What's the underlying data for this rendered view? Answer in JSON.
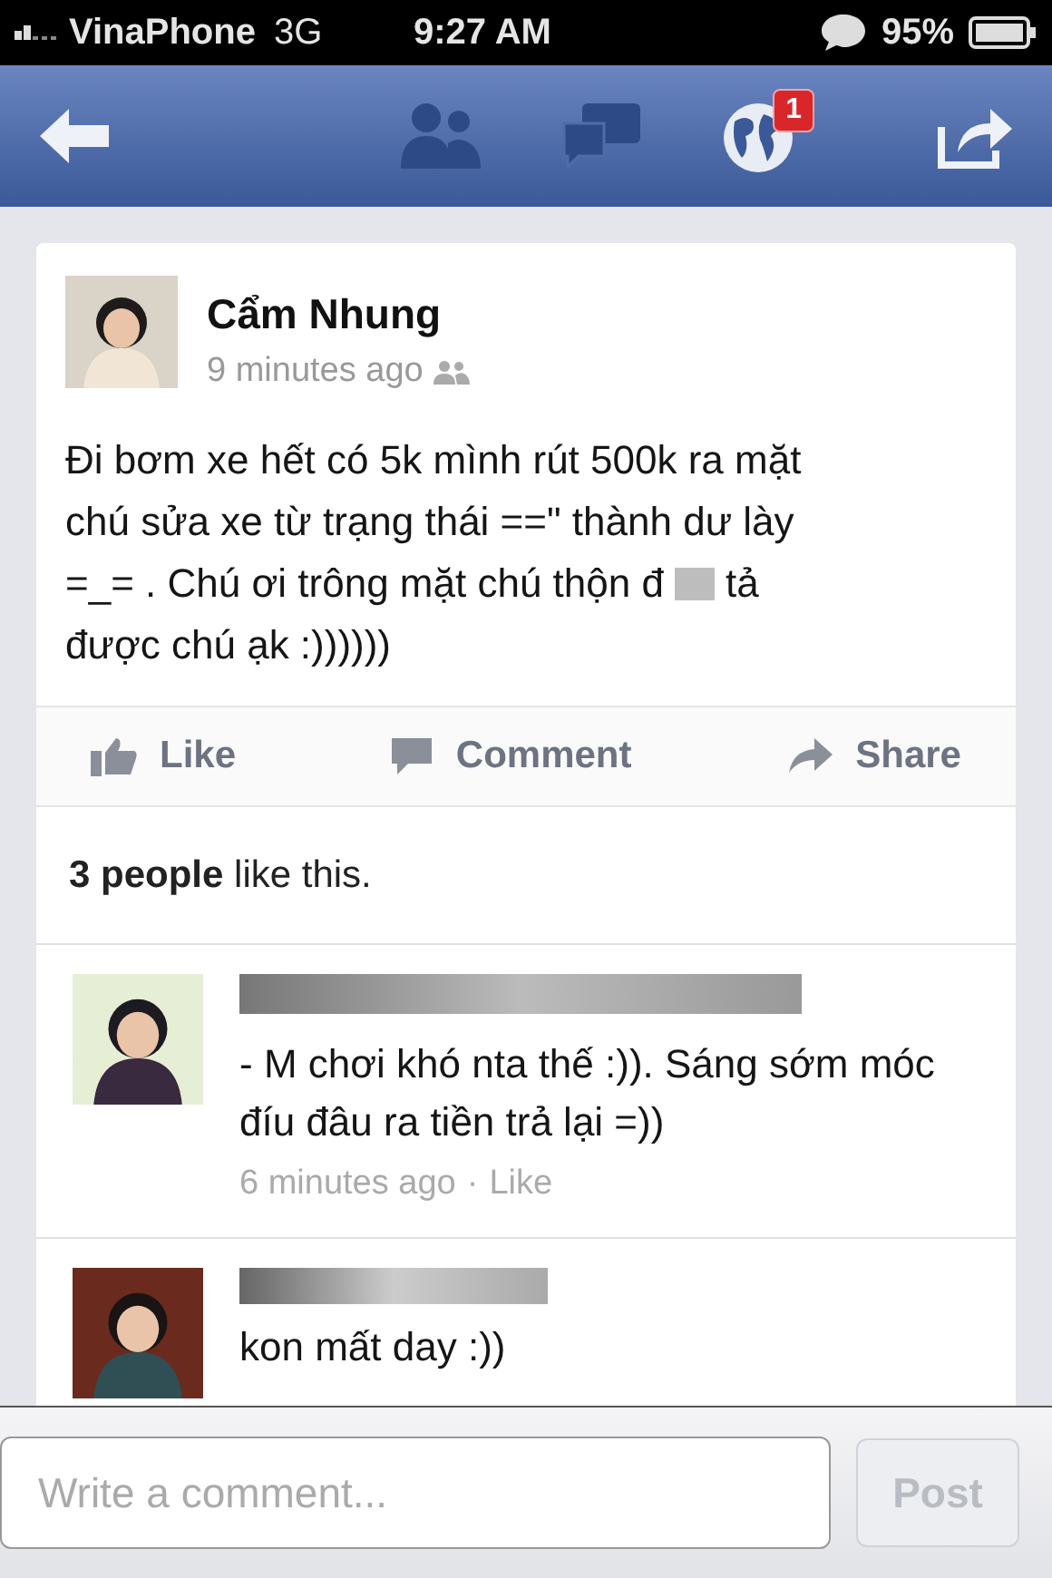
{
  "status_bar": {
    "carrier": "VinaPhone",
    "network": "3G",
    "time": "9:27 AM",
    "battery": "95%"
  },
  "nav_bar": {
    "notification_count": "1"
  },
  "post": {
    "author": "Cẩm Nhung",
    "time": "9 minutes ago",
    "text_lines": [
      [
        "Đi bơm xe hết có 5k mình rút 500k ra mặt"
      ],
      [
        "chú sửa xe từ trạng thái ==\" thành dư lày"
      ],
      [
        "=_= . Chú ơi trông mặt chú thộn đ",
        "tả"
      ],
      [
        "được chú ạk :))))))"
      ]
    ],
    "actions": [
      {
        "kind": "like",
        "label": "Like"
      },
      {
        "kind": "comment",
        "label": "Comment"
      },
      {
        "kind": "share",
        "label": "Share"
      }
    ],
    "likes_summary": "**3 people** like this."
  },
  "comments": [
    {
      "text": "- M chơi khó nta thế :)). Sáng sớm móc đíu đâu ra tiền trả lại =))",
      "time": "6 minutes ago",
      "separator": "·",
      "like": "Like"
    },
    {
      "text": "kon mất day :))"
    }
  ],
  "composer": {
    "placeholder": "Write a comment...",
    "button": "Post",
    "disabled": true
  }
}
